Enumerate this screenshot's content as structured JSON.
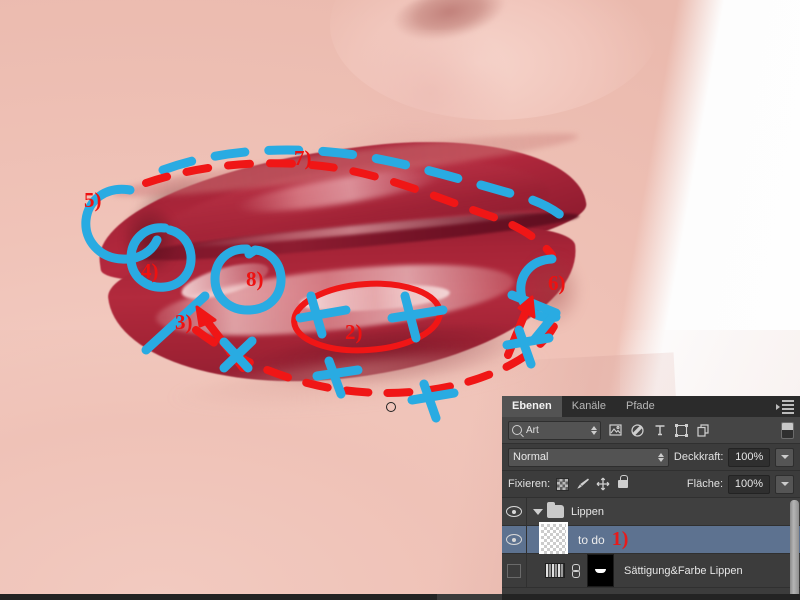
{
  "image": {
    "subject": "close-up photograph of glossy red lips, lower face with nose and chin",
    "background_color": "#f0c3b8",
    "lip_color": "#a82539",
    "white_backdrop": "#fdfdfd"
  },
  "annotations": {
    "red_color": "#ee1111",
    "blue_color": "#29abe2",
    "markers": [
      {
        "id": "1",
        "label": "1)",
        "target": "to do layer in layers panel",
        "color": "#e81b1b"
      },
      {
        "id": "2",
        "label": "2)",
        "target": "red ellipse around glossy lower-lip highlight",
        "color": "#ee1111"
      },
      {
        "id": "3",
        "label": "3)",
        "target": "arrow pointing at lower lip edge",
        "color": "#ee1111"
      },
      {
        "id": "4",
        "label": "4)",
        "target": "blue circle at left lip corner",
        "color": "#ee1111"
      },
      {
        "id": "5",
        "label": "5)",
        "target": "blue arc at outer left mouth corner",
        "color": "#ee1111"
      },
      {
        "id": "6",
        "label": "6)",
        "target": "blue arc at right mouth corner",
        "color": "#ee1111"
      },
      {
        "id": "7",
        "label": "7)",
        "target": "dashed blue line along upper lip contour",
        "color": "#ee1111"
      },
      {
        "id": "8",
        "label": "8)",
        "target": "blue circle on upper lip highlight",
        "color": "#ee1111"
      }
    ]
  },
  "panel": {
    "tabs": [
      {
        "label": "Ebenen",
        "active": true
      },
      {
        "label": "Kanäle",
        "active": false
      },
      {
        "label": "Pfade",
        "active": false
      }
    ],
    "filter": {
      "kind_value": "Art",
      "icons": [
        "image-filter-icon",
        "adjustment-filter-icon",
        "type-filter-icon",
        "shape-filter-icon",
        "smartobject-filter-icon"
      ],
      "toggle": "filter-enable-toggle"
    },
    "blend": {
      "mode": "Normal",
      "opacity_label": "Deckkraft:",
      "opacity_value": "100%"
    },
    "lock": {
      "label": "Fixieren:",
      "icons": [
        "transparency-lock-icon",
        "paint-lock-icon",
        "move-lock-icon",
        "all-lock-icon"
      ],
      "fill_label": "Fläche:",
      "fill_value": "100%"
    },
    "layers": [
      {
        "type": "group",
        "name": "Lippen",
        "visible": true,
        "expanded": true,
        "selected": false
      },
      {
        "type": "pixel",
        "name": "to do",
        "marker": "1)",
        "visible": true,
        "selected": true,
        "thumbnail": "transparent-checkerboard"
      },
      {
        "type": "adjustment",
        "name": "Sättigung&Farbe Lippen",
        "visible": false,
        "selected": false,
        "linked": true,
        "mask": "black-mask"
      }
    ]
  }
}
